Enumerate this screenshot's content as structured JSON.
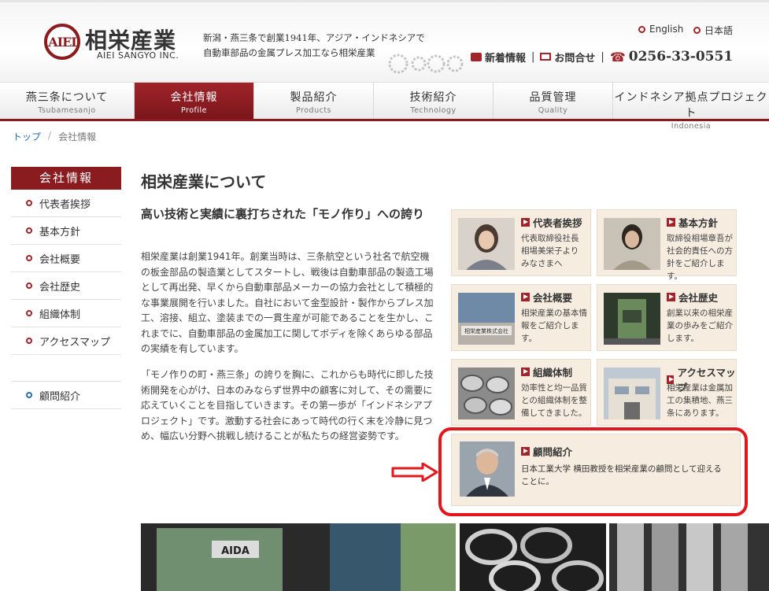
{
  "header": {
    "logo_mark": "AIEI",
    "company_name": "相栄産業",
    "company_name_en": "AIEI SANGYO INC.",
    "tagline_line1": "新潟・燕三条で創業1941年、アジア・インドネシアで",
    "tagline_line2": "自動車部品の金属プレス加工なら相栄産業",
    "lang_en": "English",
    "lang_ja": "日本語",
    "news_label": "新着情報",
    "contact_label": "お問合せ",
    "tel_icon": "☎",
    "tel": "0256-33-0551"
  },
  "nav": [
    {
      "ja": "燕三条について",
      "en": "Tsubamesanjo"
    },
    {
      "ja": "会社情報",
      "en": "Profile"
    },
    {
      "ja": "製品紹介",
      "en": "Products"
    },
    {
      "ja": "技術紹介",
      "en": "Technology"
    },
    {
      "ja": "品質管理",
      "en": "Quality"
    },
    {
      "ja": "インドネシア拠点プロジェクト",
      "en": "Indonesia"
    }
  ],
  "breadcrumb": {
    "home": "トップ",
    "sep": "/",
    "current": "会社情報"
  },
  "sidebar": {
    "title": "会社情報",
    "items": [
      "代表者挨拶",
      "基本方針",
      "会社概要",
      "会社歴史",
      "組織体制",
      "アクセスマップ"
    ],
    "extra": "顧問紹介"
  },
  "main": {
    "title": "相栄産業について",
    "lead": "高い技術と実績に裏打ちされた「モノ作り」への誇り",
    "p1": "相栄産業は創業1941年。創業当時は、三条航空という社名で航空機の板金部品の製造業としてスタートし、戦後は自動車部品の製造工場として再出発、早くから自動車部品メーカーの協力会社として積極的な事業展開を行いました。自社において金型設計・製作からプレス加工、溶接、組立、塗装までの一貫生産が可能であることを生かし、これまでに、自動車部品の金属加工に関してボディを除くあらゆる部品の実績を有しています。",
    "p2": "「モノ作りの町・燕三条」の誇りを胸に、これからも時代に即した技術開発を心がけ、日本のみならず世界中の顧客に対して、その需要に応えていくことを目指していきます。その第一歩が「インドネシアプロジェクト」です。激動する社会にあって時代の行く末を冷静に見つめ、幅広い分野へ挑戦し続けることが私たちの経営姿勢です。"
  },
  "cards": [
    {
      "title": "代表者挨拶",
      "text": "代表取締役社長 相場美栄子より みなさまへ"
    },
    {
      "title": "基本方針",
      "text": "取締役相場章吾が社会的責任への方針をご紹介します。"
    },
    {
      "title": "会社概要",
      "text": "相栄産業の基本情報をご紹介します。"
    },
    {
      "title": "会社歴史",
      "text": "創業以来の相栄産業の歩みをご紹介します。"
    },
    {
      "title": "組織体制",
      "text": "効率性と均一品質との組織体制を整備してきました。"
    },
    {
      "title": "アクセスマップ",
      "text": "相栄産業は金属加工の集積地、燕三条にあります。"
    }
  ],
  "card_wide": {
    "title": "顧問紹介",
    "text": "日本工業大学 横田教授を相栄産業の顧問として迎えることに。"
  },
  "photo_sign": "AIDA",
  "building_sign": "相栄産業株式会社",
  "colors": {
    "brand": "#8a1c20",
    "accent": "#a0242a",
    "highlight": "#e3161c",
    "card_bg": "#f6ede0",
    "link": "#2a6fb0"
  }
}
